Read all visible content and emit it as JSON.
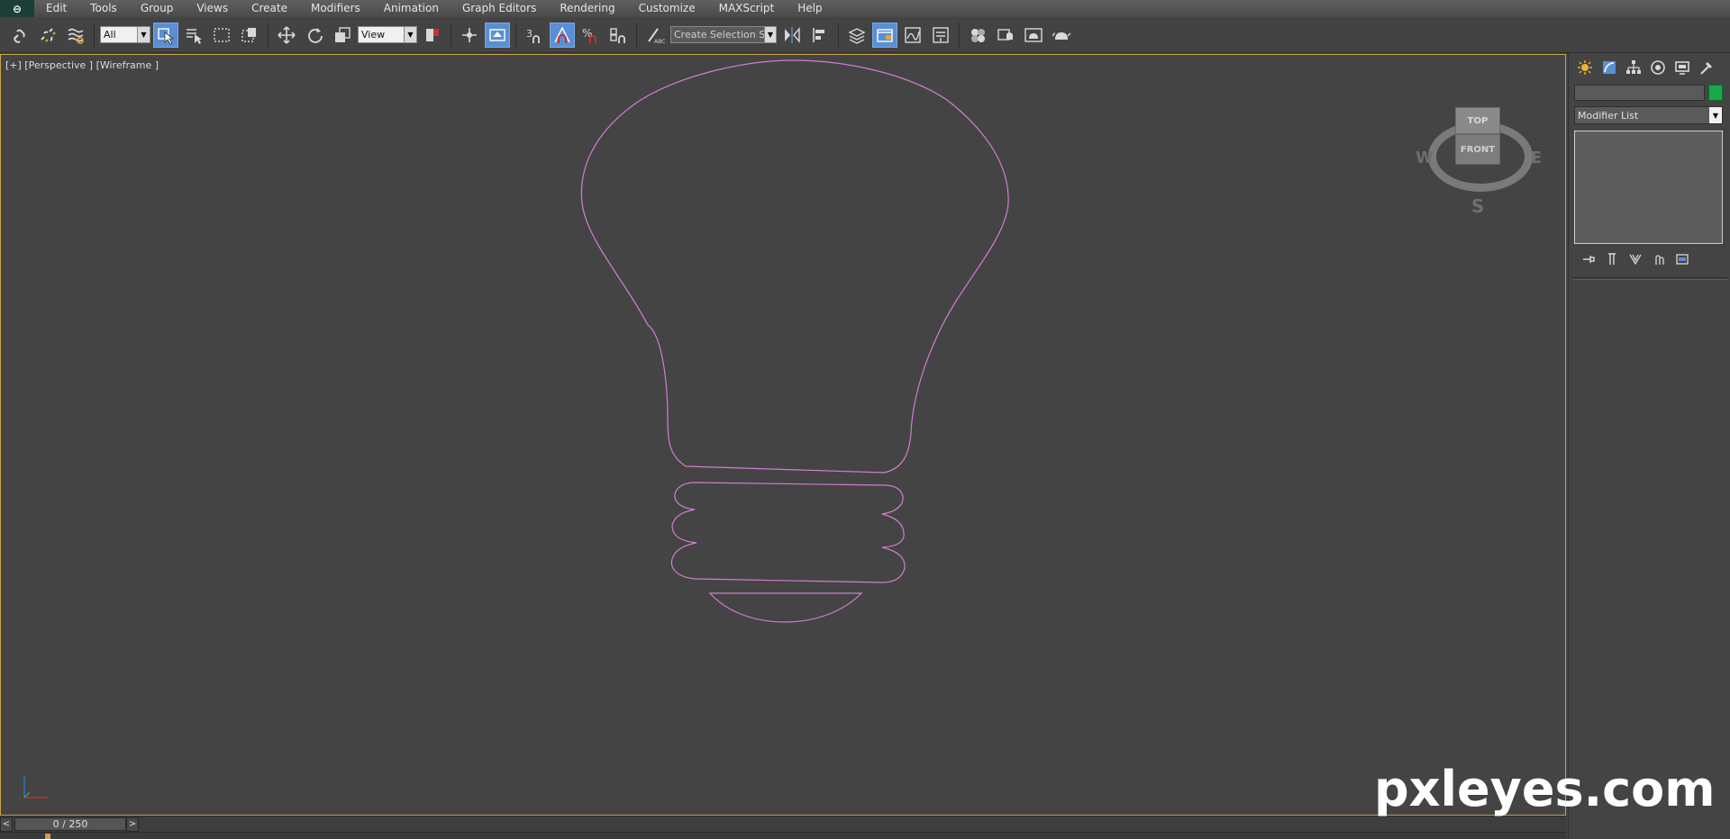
{
  "menu": {
    "items": [
      "Edit",
      "Tools",
      "Group",
      "Views",
      "Create",
      "Modifiers",
      "Animation",
      "Graph Editors",
      "Rendering",
      "Customize",
      "MAXScript",
      "Help"
    ]
  },
  "toolbar": {
    "selection_filter": "All",
    "reference_coord": "View",
    "snap_value": "3",
    "named_selection_placeholder": "Create Selection Se"
  },
  "viewport": {
    "label": "[+] [Perspective ] [Wireframe ]",
    "wire_color": "#d27dd2"
  },
  "viewcube": {
    "top": "TOP",
    "front": "FRONT",
    "west": "W",
    "east": "E",
    "south": "S"
  },
  "command_panel": {
    "modifier_list": "Modifier List",
    "object_color": "#18a84a"
  },
  "timeline": {
    "frame": "0 / 250",
    "prev": "<",
    "next": ">"
  },
  "watermark": "pxleyes.com"
}
